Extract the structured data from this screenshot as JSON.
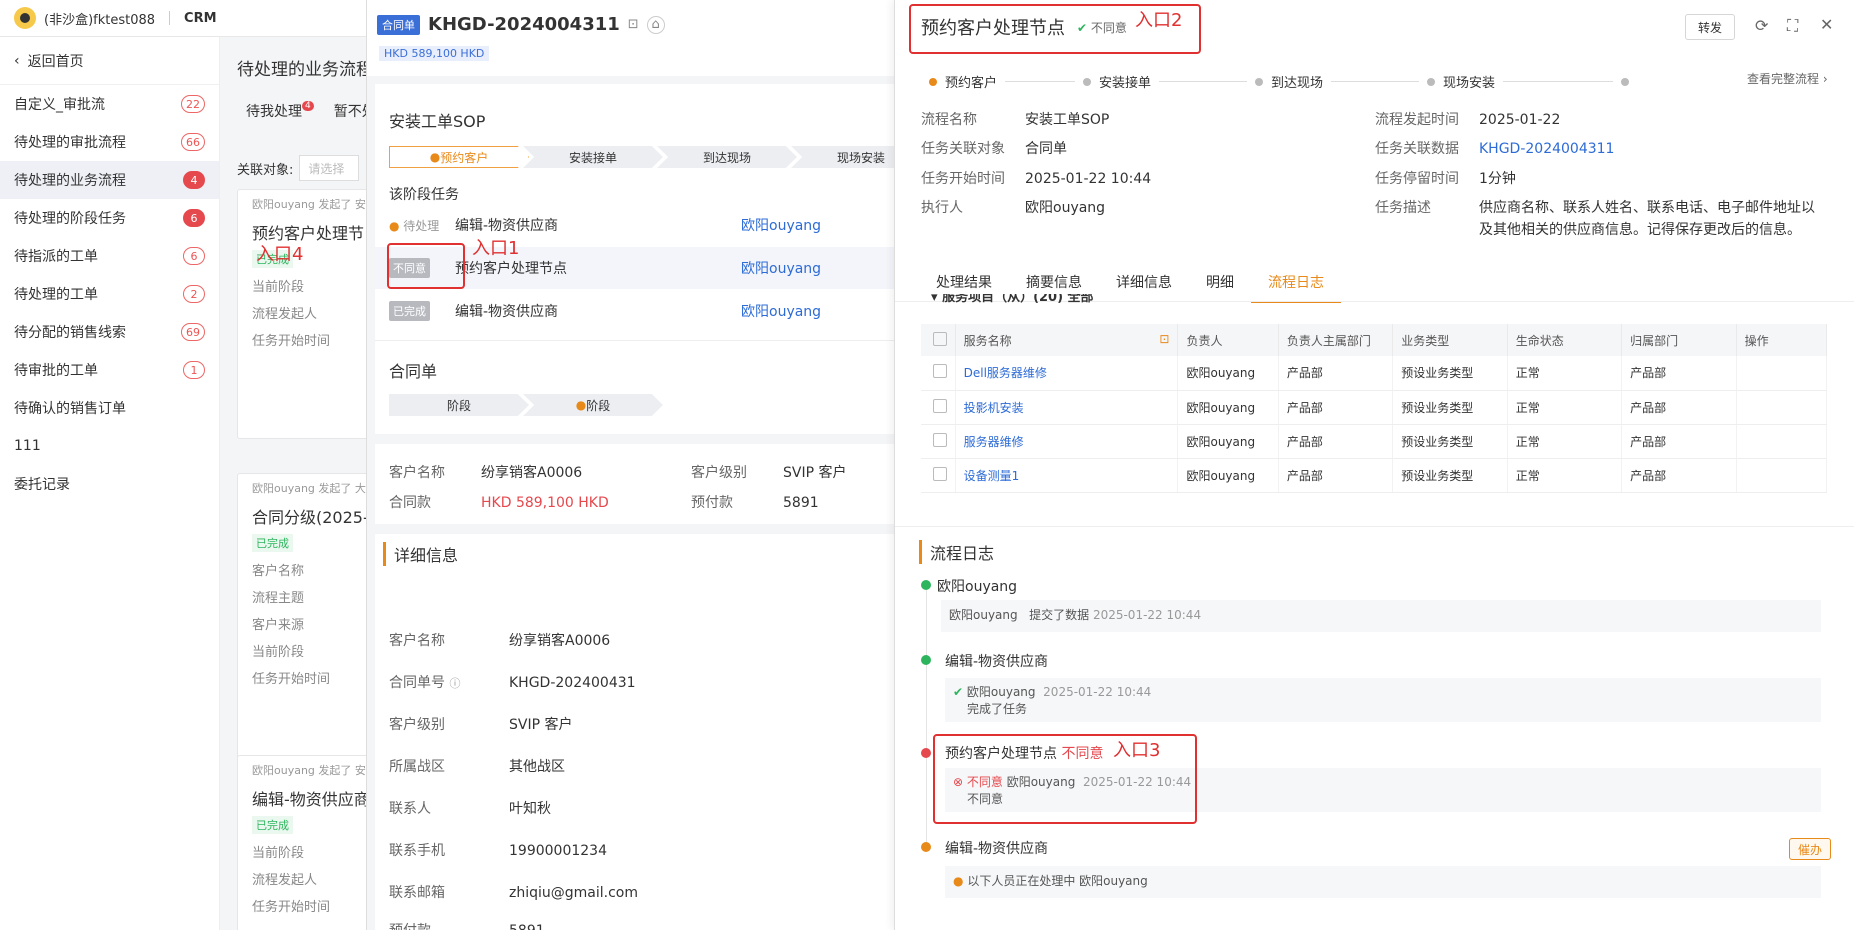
{
  "topbar": {
    "org": "(非沙盒)fktest088",
    "app": "CRM"
  },
  "sidebar": {
    "back": "返回首页",
    "items": [
      {
        "label": "自定义_审批流",
        "count": "22",
        "active": false,
        "fill": false
      },
      {
        "label": "待处理的审批流程",
        "count": "66",
        "active": false,
        "fill": false
      },
      {
        "label": "待处理的业务流程",
        "count": "4",
        "active": true,
        "fill": true
      },
      {
        "label": "待处理的阶段任务",
        "count": "6",
        "active": false,
        "fill": true
      },
      {
        "label": "待指派的工单",
        "count": "6",
        "active": false,
        "fill": false
      },
      {
        "label": "待处理的工单",
        "count": "2",
        "active": false,
        "fill": false
      },
      {
        "label": "待分配的销售线索",
        "count": "69",
        "active": false,
        "fill": false
      },
      {
        "label": "待审批的工单",
        "count": "1",
        "active": false,
        "fill": false
      },
      {
        "label": "待确认的销售订单",
        "count": "",
        "active": false,
        "fill": false
      },
      {
        "label": "111",
        "count": "",
        "active": false,
        "fill": false
      },
      {
        "label": "委托记录",
        "count": "",
        "active": false,
        "fill": false
      }
    ]
  },
  "midlist": {
    "title": "待处理的业务流程",
    "tab1": "待我处理",
    "tab1_count": "4",
    "tab2": "暂不处",
    "filter_label": "关联对象:",
    "filter_placeholder": "请选择",
    "cards": [
      {
        "meta": "欧阳ouyang 发起了 安",
        "title": "预约客户处理节",
        "tag": "已完成",
        "fields": [
          "当前阶段",
          "流程发起人",
          "任务开始时间"
        ]
      },
      {
        "meta": "欧阳ouyang 发起了 大",
        "title": "合同分级(2025-0",
        "tag": "已完成",
        "fields": [
          "客户名称",
          "流程主题",
          "客户来源",
          "当前阶段",
          "任务开始时间"
        ]
      },
      {
        "meta": "欧阳ouyang 发起了 安",
        "title": "编辑-物资供应商",
        "tag": "已完成",
        "fields": [
          "当前阶段",
          "流程发起人",
          "任务开始时间"
        ]
      }
    ]
  },
  "contract": {
    "tag": "合同单",
    "code": "KHGD-2024004311",
    "amount": "HKD 589,100 HKD",
    "sop_title": "安装工单SOP",
    "steps": [
      "预约客户",
      "安装接单",
      "到达现场",
      "现场安装"
    ],
    "stage_tasks_title": "该阶段任务",
    "tasks": [
      {
        "status": "待处理",
        "name": "编辑-物资供应商",
        "owner": "欧阳ouyang"
      },
      {
        "status": "不同意",
        "name": "预约客户处理节点",
        "owner": "欧阳ouyang"
      },
      {
        "status": "已完成",
        "name": "编辑-物资供应商",
        "owner": "欧阳ouyang"
      }
    ],
    "contract_title": "合同单",
    "contract_steps": [
      "阶段",
      "阶段"
    ],
    "info": [
      {
        "k": "客户名称",
        "v": "纷享销客A0006"
      },
      {
        "k": "客户级别",
        "v": "SVIP 客户"
      },
      {
        "k": "合同款",
        "v": "HKD 589,100 HKD"
      },
      {
        "k": "预付款",
        "v": "5891"
      }
    ],
    "detail_title": "详细信息",
    "detail": [
      {
        "k": "客户名称",
        "v": "纷享销客A0006"
      },
      {
        "k": "合同单号",
        "v": "KHGD-202400431"
      },
      {
        "k": "客户级别",
        "v": "SVIP 客户"
      },
      {
        "k": "所属战区",
        "v": "其他战区"
      },
      {
        "k": "联系人",
        "v": "叶知秋"
      },
      {
        "k": "联系手机",
        "v": "19900001234"
      },
      {
        "k": "联系邮箱",
        "v": "zhiqiu@gmail.com"
      },
      {
        "k": "预付款",
        "v": "5891"
      }
    ]
  },
  "node": {
    "title": "预约客户处理节点",
    "status": "不同意",
    "forward": "转发",
    "progress": [
      "预约客户",
      "安装接单",
      "到达现场",
      "现场安装"
    ],
    "full_flow": "查看完整流程",
    "fields_left": [
      {
        "k": "流程名称",
        "v": "安装工单SOP"
      },
      {
        "k": "任务关联对象",
        "v": "合同单"
      },
      {
        "k": "任务开始时间",
        "v": "2025-01-22 10:44"
      },
      {
        "k": "执行人",
        "v": "欧阳ouyang"
      }
    ],
    "fields_right": [
      {
        "k": "流程发起时间",
        "v": "2025-01-22"
      },
      {
        "k": "任务关联数据",
        "v": "KHGD-2024004311"
      },
      {
        "k": "任务停留时间",
        "v": "1分钟"
      },
      {
        "k": "任务描述",
        "v": "供应商名称、联系人姓名、联系电话、电子邮件地址以"
      },
      {
        "k": "",
        "v": "及其他相关的供应商信息。记得保存更改后的信息。"
      }
    ],
    "tabs": [
      "处理结果",
      "摘要信息",
      "详细信息",
      "明细",
      "流程日志"
    ],
    "subsection": "服务项目（从）(20) 全部",
    "table_headers": [
      "服务名称",
      "负责人",
      "负责人主属部门",
      "业务类型",
      "生命状态",
      "归属部门",
      "操作"
    ],
    "table_rows": [
      [
        "Dell服务器维修",
        "欧阳ouyang",
        "产品部",
        "预设业务类型",
        "正常",
        "产品部"
      ],
      [
        "投影机安装",
        "欧阳ouyang",
        "产品部",
        "预设业务类型",
        "正常",
        "产品部"
      ],
      [
        "服务器维修",
        "欧阳ouyang",
        "产品部",
        "预设业务类型",
        "正常",
        "产品部"
      ],
      [
        "设备测量1",
        "欧阳ouyang",
        "产品部",
        "预设业务类型",
        "正常",
        "产品部"
      ]
    ],
    "log_title": "流程日志",
    "log": {
      "n1": "欧阳ouyang",
      "n1_user": "欧阳ouyang",
      "n1_text": "提交了数据",
      "n1_time": "2025-01-22 10:44",
      "n2": "编辑-物资供应商",
      "n2_user": "欧阳ouyang",
      "n2_time": "2025-01-22 10:44",
      "n2_text": "完成了任务",
      "n3": "预约客户处理节点",
      "n3_status": "不同意",
      "n3_tag": "不同意",
      "n3_user": "欧阳ouyang",
      "n3_time": "2025-01-22 10:44",
      "n3_text": "不同意",
      "n4": "编辑-物资供应商",
      "n4_btn": "催办",
      "n4_text": "以下人员正在处理中 欧阳ouyang"
    }
  },
  "annotations": {
    "a1": "入口1",
    "a2": "入口2",
    "a3": "入口3",
    "a4": "入口4"
  }
}
